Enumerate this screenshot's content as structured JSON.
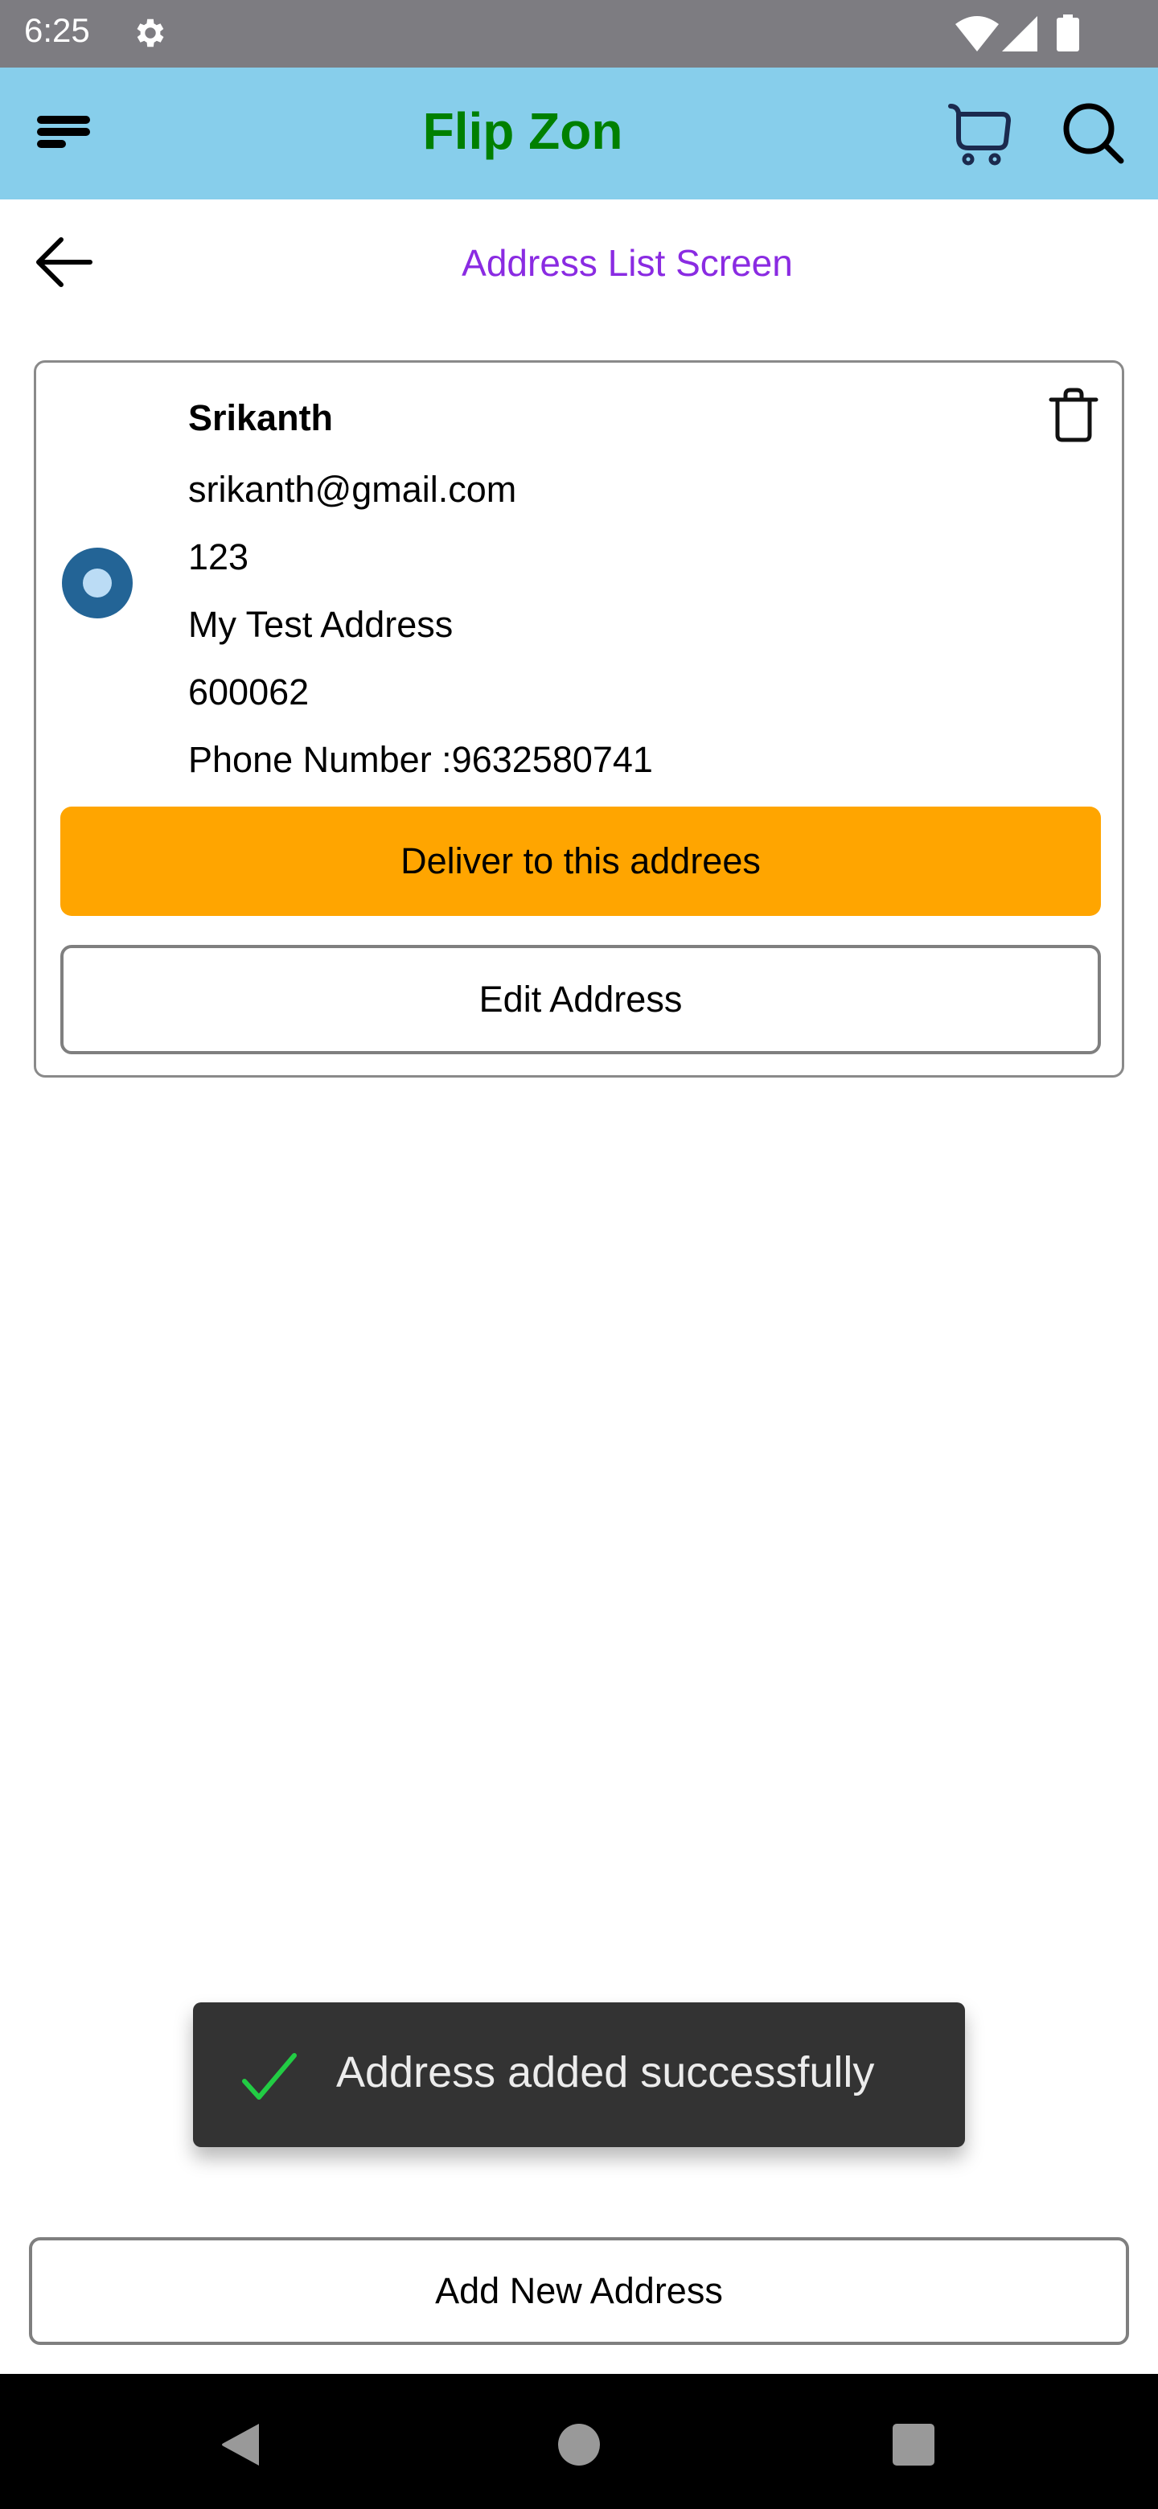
{
  "status_bar": {
    "time": "6:25",
    "icons": [
      "gear-icon",
      "wifi-icon",
      "signal-icon",
      "battery-icon"
    ]
  },
  "header": {
    "title": "Flip Zon",
    "title_color": "#008000",
    "background": "#87ceeb",
    "icons": [
      "menu-icon",
      "cart-icon",
      "search-icon"
    ]
  },
  "page": {
    "title": "Address List Screen",
    "title_color": "#8a2be2",
    "back_icon": "arrow-left-icon"
  },
  "addresses": [
    {
      "selected": true,
      "name": "Srikanth",
      "email": "srikanth@gmail.com",
      "house": "123",
      "street": "My Test Address",
      "pincode": "600062",
      "phone_label": "Phone Number :",
      "phone": "9632580741",
      "phone_line": "Phone Number :9632580741",
      "deliver_label": "Deliver to this addrees",
      "edit_label": "Edit Address",
      "delete_icon": "trash-icon"
    }
  ],
  "colors": {
    "deliver_button": "#ffa500",
    "radio_selected": "#236496",
    "toast_background": "#333333",
    "toast_check": "#22cc44"
  },
  "toast": {
    "icon": "checkmark-icon",
    "message": "Address added successfully"
  },
  "footer": {
    "add_new_label": "Add New Address"
  },
  "nav_bar": {
    "buttons": [
      "back",
      "home",
      "recents"
    ]
  }
}
